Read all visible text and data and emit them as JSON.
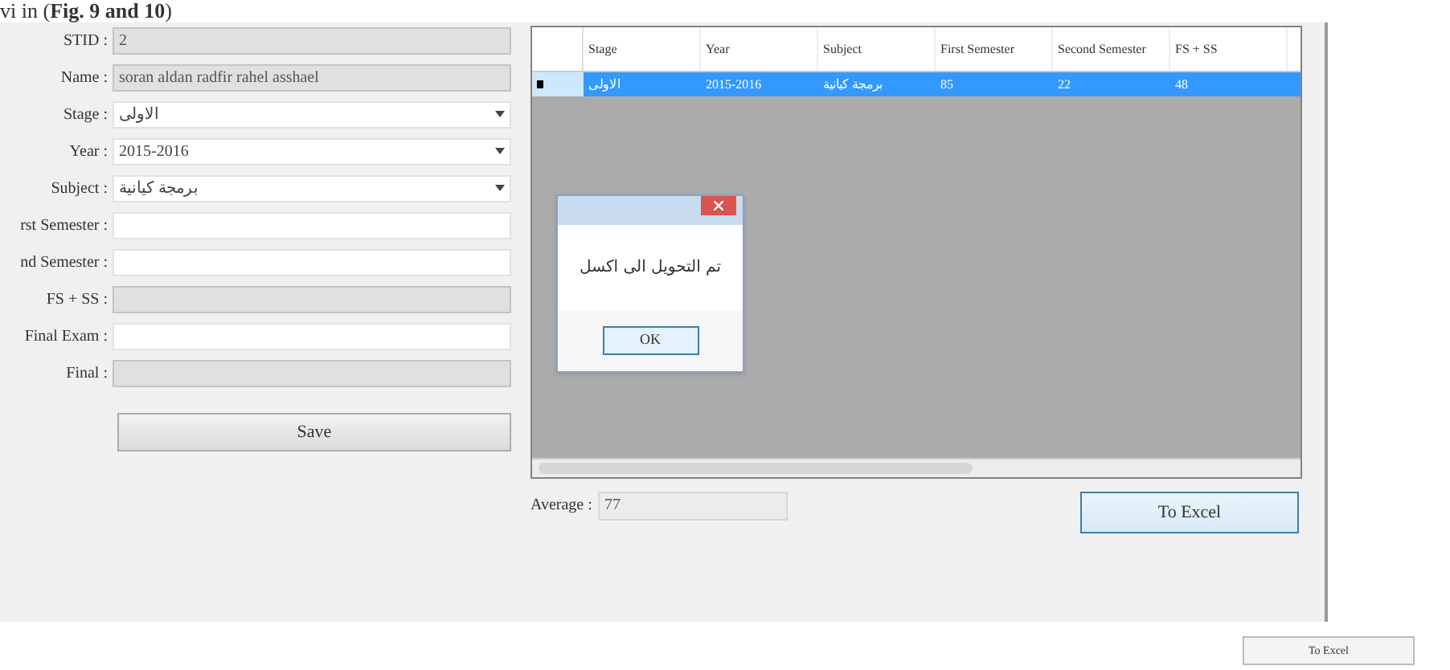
{
  "caption": "vi in (**Fig. 9 and 10**)",
  "form": {
    "fields": [
      {
        "label": "STID :",
        "kind": "text",
        "value": "2",
        "disabled": true
      },
      {
        "label": "Name :",
        "kind": "text",
        "value": "soran aldan radfir rahel asshael",
        "disabled": true
      },
      {
        "label": "Stage :",
        "kind": "combo",
        "value": "الاولى",
        "disabled": false
      },
      {
        "label": "Year :",
        "kind": "combo",
        "value": "2015-2016",
        "disabled": false
      },
      {
        "label": "Subject :",
        "kind": "combo",
        "value": "برمجة كيانية",
        "disabled": false
      },
      {
        "label": "rst Semester :",
        "kind": "text",
        "disabled": false
      },
      {
        "label": "nd Semester :",
        "kind": "text",
        "disabled": false
      },
      {
        "label": "FS + SS :",
        "kind": "text",
        "disabled": true
      },
      {
        "label": "Final Exam :",
        "kind": "text",
        "disabled": false
      },
      {
        "label": "Final :",
        "kind": "text",
        "disabled": true
      }
    ],
    "save_button": "Save"
  },
  "table": {
    "columns": [
      "Stage",
      "Year",
      "Subject",
      "First Semester",
      "Second Semester",
      "FS + SS"
    ],
    "rows": [
      {
        "selected": true,
        "cells": [
          "الاولى",
          "2015-2016",
          "برمجة كيانية",
          "85",
          "22",
          "48"
        ]
      }
    ]
  },
  "dialog": {
    "message": "تم التحويل الى اكسل",
    "ok_button": "OK"
  },
  "average": {
    "label": "Average :",
    "value": "77"
  },
  "excel_button": "To Excel",
  "bottom_button": "To Excel"
}
